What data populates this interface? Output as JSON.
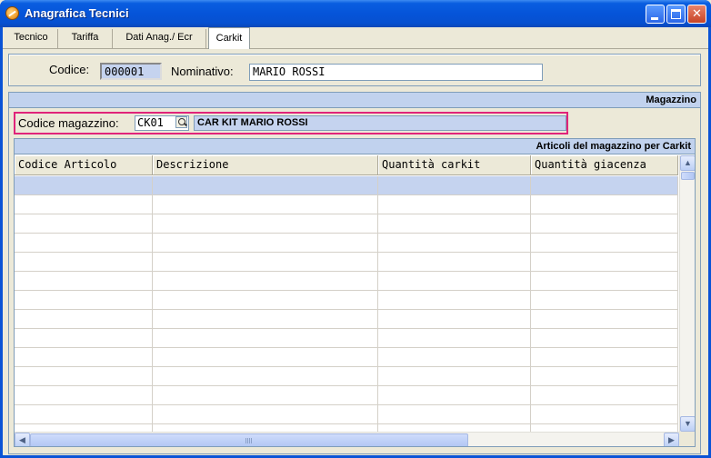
{
  "window": {
    "title": "Anagrafica Tecnici",
    "controls": {
      "minimize": "minimize",
      "maximize": "maximize",
      "close": "✕"
    }
  },
  "tabs": [
    {
      "label": "Tecnico"
    },
    {
      "label": "Tariffa"
    },
    {
      "label": "Dati Anag./ Ecr"
    },
    {
      "label": "Carkit",
      "active": true
    }
  ],
  "header": {
    "codice_label": "Codice:",
    "codice_value": "000001",
    "nominativo_label": "Nominativo:",
    "nominativo_value": "MARIO ROSSI"
  },
  "magazzino": {
    "section_title": "Magazzino",
    "codice_label": "Codice magazzino:",
    "codice_value": "CK01",
    "descrizione_value": "CAR KIT MARIO ROSSI"
  },
  "grid": {
    "title": "Articoli del magazzino per Carkit",
    "columns": [
      "Codice Articolo",
      "Descrizione",
      "Quantità carkit",
      "Quantità giacenza"
    ],
    "rows": [],
    "scroll": {
      "up": "▲",
      "down": "▼",
      "left": "◀",
      "right": "▶"
    }
  },
  "colors": {
    "titlebar": "#0554d9",
    "section_header": "#c1d2ee",
    "readonly_field": "#c5d3ef",
    "highlight_border": "#e0247a"
  }
}
